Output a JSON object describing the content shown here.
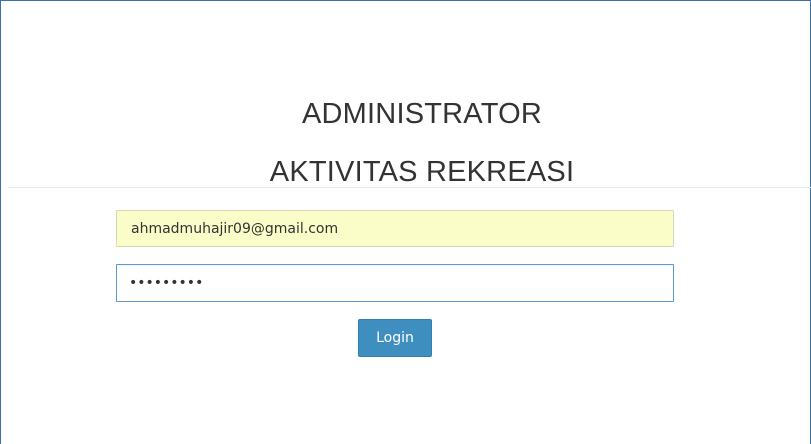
{
  "header": {
    "title_line1": "ADMINISTRATOR",
    "title_line2": "AKTIVITAS REKREASI"
  },
  "form": {
    "email_value": "ahmadmuhajir09@gmail.com",
    "password_value": "123456789",
    "login_label": "Login"
  },
  "colors": {
    "email_autofill_bg": "#fafdc8",
    "focus_border": "#5b9bd1",
    "button_bg": "#3f8ec0",
    "frame_border": "#3c6fa6"
  }
}
